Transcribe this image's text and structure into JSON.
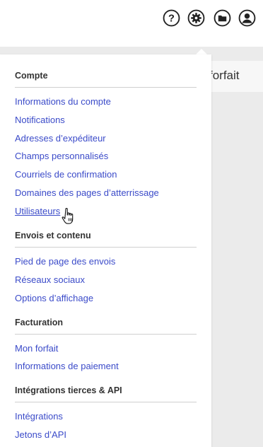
{
  "topbar": {
    "icons": [
      "help-icon",
      "gear-icon",
      "folder-icon",
      "user-icon"
    ]
  },
  "background": {
    "plan_label": "forfait"
  },
  "menu": {
    "sections": [
      {
        "title": "Compte",
        "items": [
          "Informations du compte",
          "Notifications",
          "Adresses d’expéditeur",
          "Champs personnalisés",
          "Courriels de confirmation",
          "Domaines des pages d’atterrissage",
          "Utilisateurs"
        ]
      },
      {
        "title": "Envois et contenu",
        "items": [
          "Pied de page des envois",
          "Réseaux sociaux",
          "Options d’affichage"
        ]
      },
      {
        "title": "Facturation",
        "items": [
          "Mon forfait",
          "Informations de paiement"
        ]
      },
      {
        "title": "Intégrations tierces & API",
        "items": [
          "Intégrations",
          "Jetons d’API"
        ]
      }
    ]
  },
  "colors": {
    "link": "#3b4bc9",
    "heading": "#333333",
    "backdrop": "#ebebeb"
  }
}
